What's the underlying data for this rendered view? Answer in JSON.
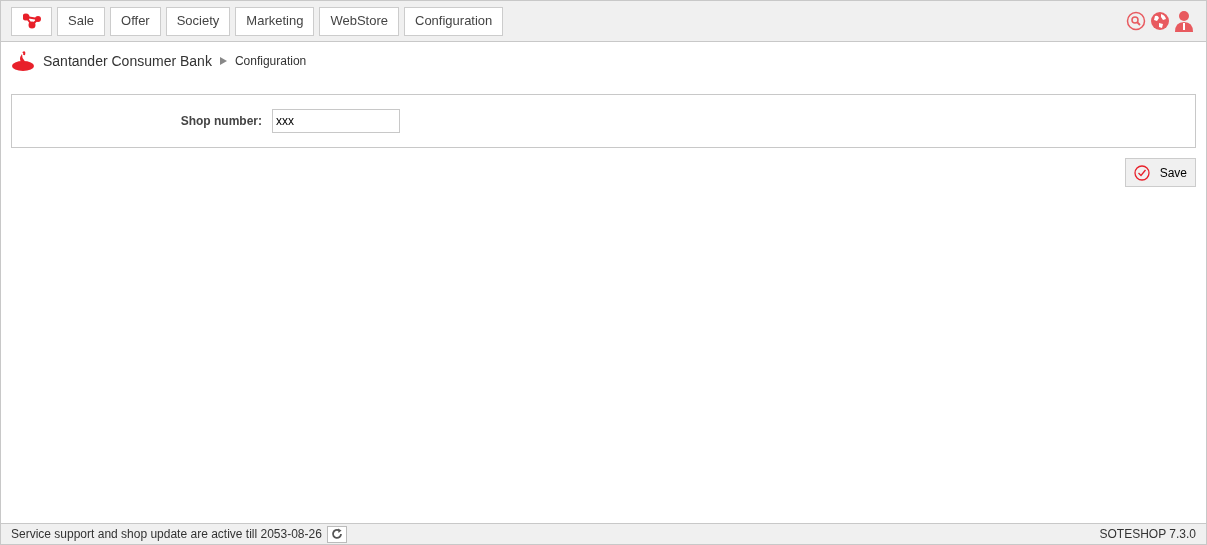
{
  "menu": [
    "Sale",
    "Offer",
    "Society",
    "Marketing",
    "WebStore",
    "Configuration"
  ],
  "breadcrumb": {
    "title": "Santander Consumer Bank",
    "current": "Configuration"
  },
  "form": {
    "label": "Shop number:",
    "value": "xxx"
  },
  "save_button": "Save",
  "status_bar": {
    "message": "Service support and shop update are active till 2053-08-26",
    "version": "SOTESHOP 7.3.0"
  }
}
